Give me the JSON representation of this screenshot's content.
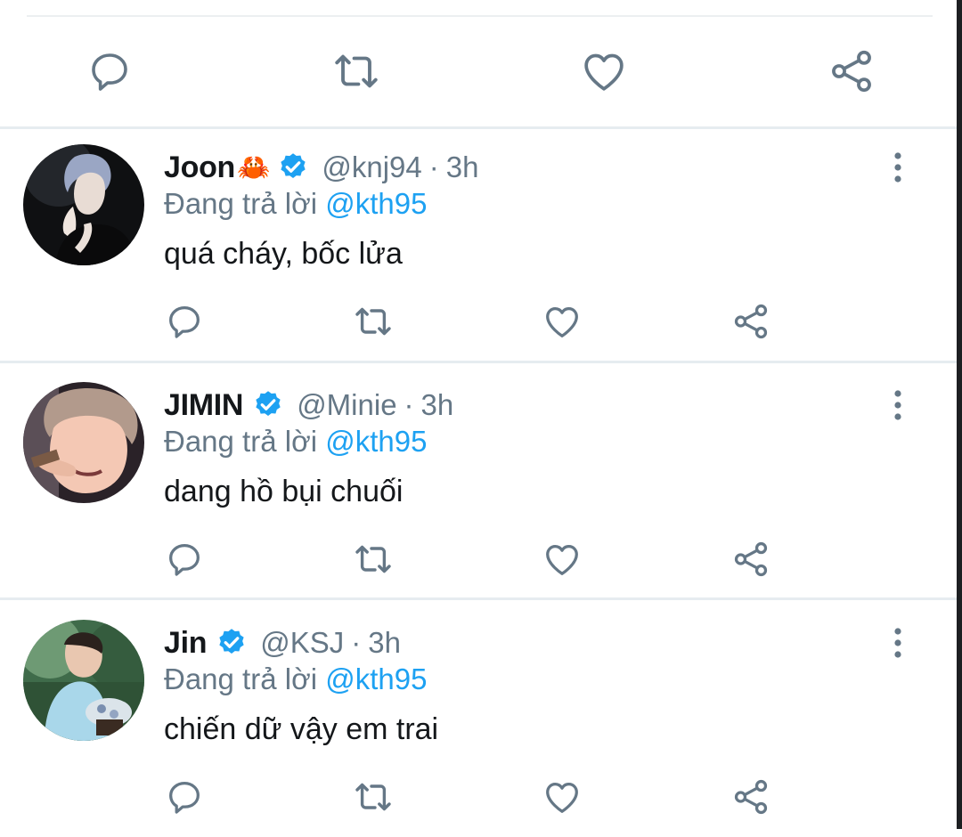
{
  "colors": {
    "accent": "#1da1f2",
    "muted": "#657786",
    "text": "#14171a",
    "icon": "#657786"
  },
  "main_actions": [
    "reply-icon",
    "retweet-icon",
    "like-icon",
    "share-icon"
  ],
  "replies": [
    {
      "name": "Joon",
      "emoji": "🦀",
      "verified": true,
      "handle": "@knj94",
      "separator": "·",
      "time": "3h",
      "reply_prefix": "Đang trả lời",
      "reply_to": "@kth95",
      "text": "quá cháy, bốc lửa"
    },
    {
      "name": "JIMIN",
      "emoji": "",
      "verified": true,
      "handle": "@Minie",
      "separator": "·",
      "time": "3h",
      "reply_prefix": "Đang trả lời",
      "reply_to": "@kth95",
      "text": "dang hồ bụi chuối"
    },
    {
      "name": "Jin",
      "emoji": "",
      "verified": true,
      "handle": "@KSJ",
      "separator": "·",
      "time": "3h",
      "reply_prefix": "Đang trả lời",
      "reply_to": "@kth95",
      "text": "chiến dữ vậy em trai"
    }
  ]
}
